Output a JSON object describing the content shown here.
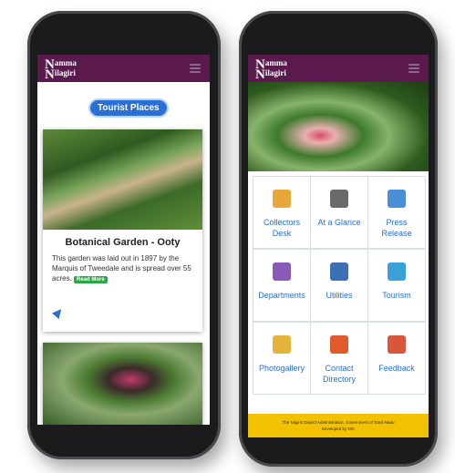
{
  "left_phone": {
    "app": {
      "logo_big_1": "N",
      "logo_small_1": "amma",
      "logo_big_2": "N",
      "logo_small_2": "ilagiri"
    },
    "section_label": "Tourist Places",
    "card": {
      "title": "Botanical Garden - Ooty",
      "description": "This garden was laid out in 1897 by the Marquis of Tweedale and is spread over 55 acres.",
      "read_more": "Read More"
    }
  },
  "right_phone": {
    "app": {
      "logo_big_1": "N",
      "logo_small_1": "amma",
      "logo_big_2": "N",
      "logo_small_2": "ilagiri"
    },
    "tiles": [
      {
        "label": "Collectors Desk",
        "icon": "desk-icon",
        "color": "#e9a73a"
      },
      {
        "label": "At a Glance",
        "icon": "binoculars-icon",
        "color": "#6a6a6a"
      },
      {
        "label": "Press Release",
        "icon": "newspaper-icon",
        "color": "#4a90d9"
      },
      {
        "label": "Departments",
        "icon": "building-icon",
        "color": "#8a5ab8"
      },
      {
        "label": "Utilities",
        "icon": "utilities-icon",
        "color": "#3b6fb6"
      },
      {
        "label": "Tourism",
        "icon": "tourism-icon",
        "color": "#3aa0d8"
      },
      {
        "label": "Photogallery",
        "icon": "photogallery-icon",
        "color": "#e2b43a"
      },
      {
        "label": "Contact Directory",
        "icon": "contact-book-icon",
        "color": "#e05a2a"
      },
      {
        "label": "Feedback",
        "icon": "feedback-icon",
        "color": "#d8563a"
      }
    ],
    "footer": {
      "line1": "The Nilgiris District Administration, Government of Tamil Nadu",
      "line2": "Developed by NIC"
    }
  }
}
